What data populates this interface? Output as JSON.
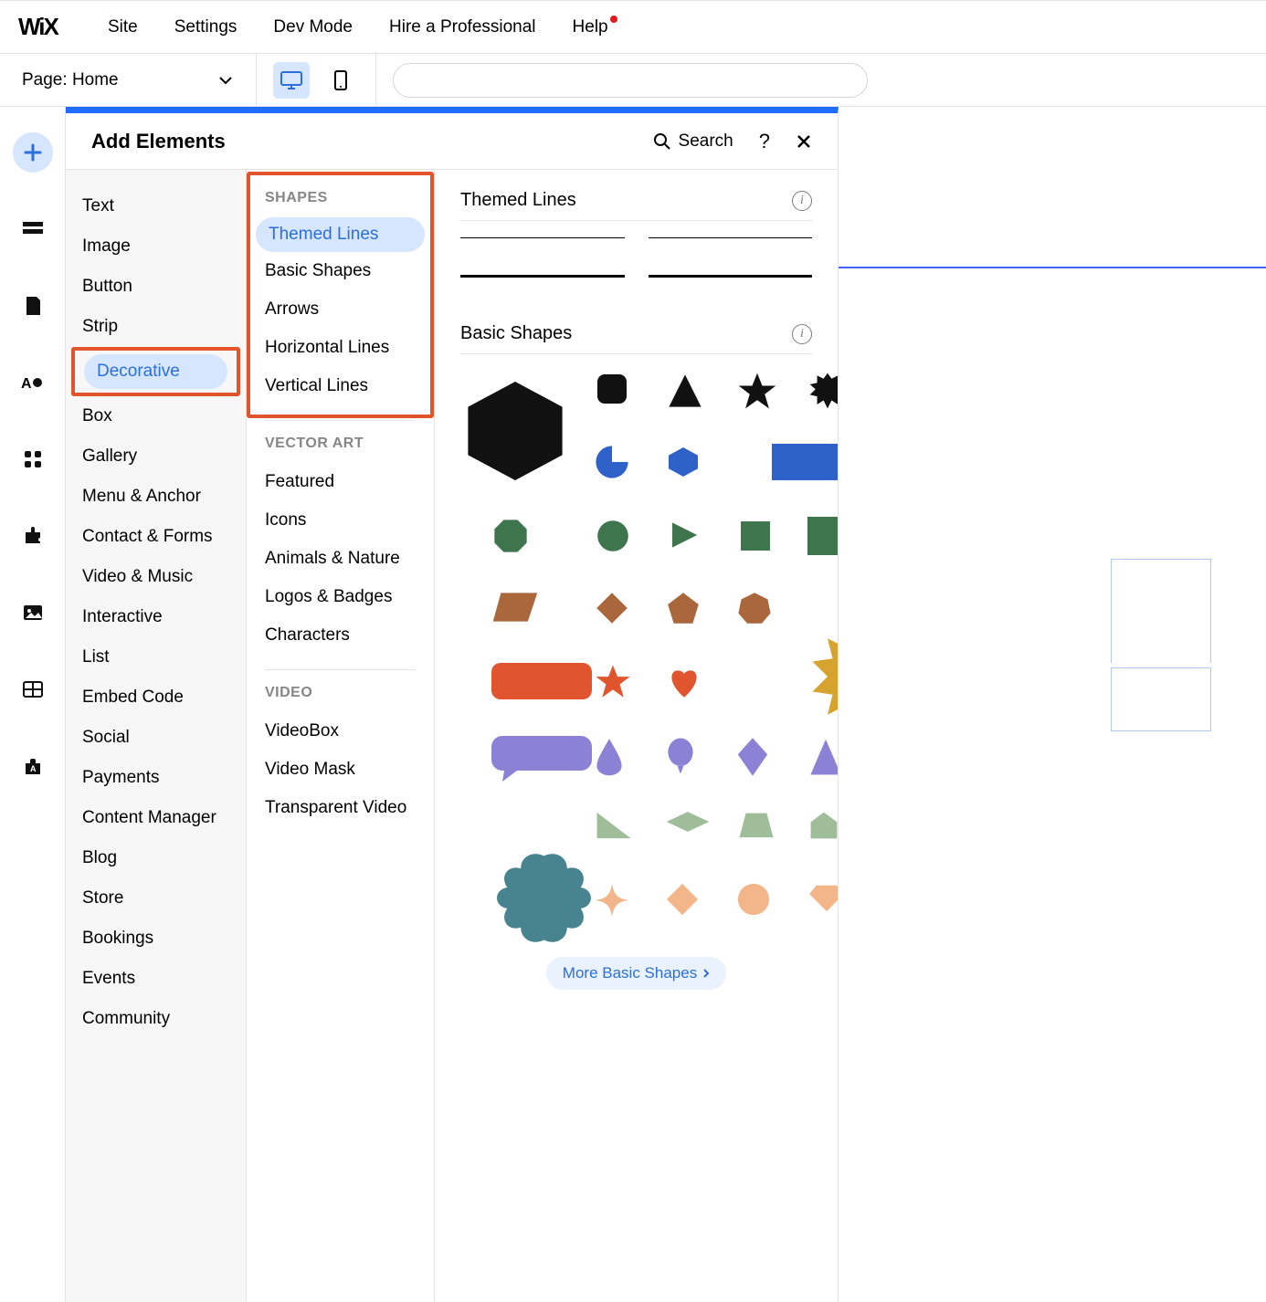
{
  "topbar": {
    "logo": "WiX",
    "menu": [
      "Site",
      "Settings",
      "Dev Mode",
      "Hire a Professional",
      "Help"
    ]
  },
  "pagebar": {
    "label_prefix": "Page:",
    "page_name": "Home"
  },
  "panel": {
    "title": "Add Elements",
    "search_label": "Search"
  },
  "categories": [
    "Text",
    "Image",
    "Button",
    "Strip",
    "Decorative",
    "Box",
    "Gallery",
    "Menu & Anchor",
    "Contact & Forms",
    "Video & Music",
    "Interactive",
    "List",
    "Embed Code",
    "Social",
    "Payments",
    "Content Manager",
    "Blog",
    "Store",
    "Bookings",
    "Events",
    "Community"
  ],
  "subgroups": {
    "shapes": {
      "title": "SHAPES",
      "items": [
        "Themed Lines",
        "Basic Shapes",
        "Arrows",
        "Horizontal Lines",
        "Vertical Lines"
      ]
    },
    "vector": {
      "title": "VECTOR ART",
      "items": [
        "Featured",
        "Icons",
        "Animals & Nature",
        "Logos & Badges",
        "Characters"
      ]
    },
    "video": {
      "title": "VIDEO",
      "items": [
        "VideoBox",
        "Video Mask",
        "Transparent Video"
      ]
    }
  },
  "sections": {
    "themed_lines": "Themed Lines",
    "basic_shapes": "Basic Shapes",
    "more_basic": "More Basic Shapes"
  },
  "colors": {
    "black": "#111111",
    "blue": "#2e62c9",
    "green": "#3e754c",
    "brown": "#a9673b",
    "gold": "#d6a32e",
    "orange": "#e0552d",
    "purple": "#8b82d6",
    "teal": "#47848f",
    "sage": "#a0bd9a",
    "peach": "#f3b58a"
  }
}
